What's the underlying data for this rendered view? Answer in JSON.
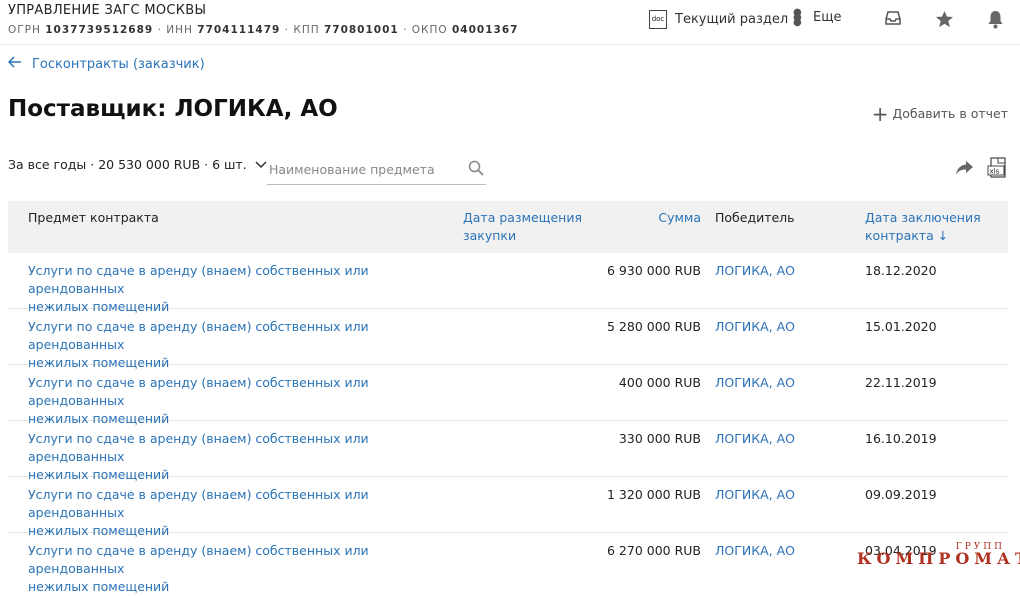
{
  "header": {
    "org_name": "УПРАВЛЕНИЕ ЗАГС МОСКВЫ",
    "ogrn_label": "ОГРН",
    "ogrn": "1037739512689",
    "inn_label": "ИНН",
    "inn": "7704111479",
    "kpp_label": "КПП",
    "kpp": "770801001",
    "okpo_label": "ОКПО",
    "okpo": "04001367",
    "separator": "·",
    "doc_icon_text": "doc",
    "current_section_label": "Текущий раздел",
    "more_label": "Еще"
  },
  "breadcrumb": {
    "back_label": "Госконтракты (заказчик)"
  },
  "page": {
    "title": "Поставщик: ЛОГИКА, АО",
    "add_report_label": "Добавить в отчет"
  },
  "filters": {
    "summary": "За все годы · 20 530 000 RUB · 6 шт.",
    "search_placeholder": "Наименование предмета",
    "xls_icon_text": "xls"
  },
  "table": {
    "columns": {
      "subject": "Предмет контракта",
      "placement_date_line1": "Дата размещения",
      "placement_date_line2": "закупки",
      "sum": "Сумма",
      "winner": "Победитель",
      "contract_date_line1": "Дата заключения",
      "contract_date_line2": "контракта ↓"
    },
    "rows": [
      {
        "subject_line1": "Услуги по сдаче в аренду (внаем) собственных или арендованных",
        "subject_line2": "нежилых помещений",
        "sum": "6 930 000 RUB",
        "winner": "ЛОГИКА, АО",
        "date": "18.12.2020"
      },
      {
        "subject_line1": "Услуги по сдаче в аренду (внаем) собственных или арендованных",
        "subject_line2": "нежилых помещений",
        "sum": "5 280 000 RUB",
        "winner": "ЛОГИКА, АО",
        "date": "15.01.2020"
      },
      {
        "subject_line1": "Услуги по сдаче в аренду (внаем) собственных или арендованных",
        "subject_line2": "нежилых помещений",
        "sum": "400 000 RUB",
        "winner": "ЛОГИКА, АО",
        "date": "22.11.2019"
      },
      {
        "subject_line1": "Услуги по сдаче в аренду (внаем) собственных или арендованных",
        "subject_line2": "нежилых помещений",
        "sum": "330 000 RUB",
        "winner": "ЛОГИКА, АО",
        "date": "16.10.2019"
      },
      {
        "subject_line1": "Услуги по сдаче в аренду (внаем) собственных или арендованных",
        "subject_line2": "нежилых помещений",
        "sum": "1 320 000 RUB",
        "winner": "ЛОГИКА, АО",
        "date": "09.09.2019"
      },
      {
        "subject_line1": "Услуги по сдаче в аренду (внаем) собственных или арендованных",
        "subject_line2": "нежилых помещений",
        "sum": "6 270 000 RUB",
        "winner": "ЛОГИКА, АО",
        "date": "03.04.2019"
      }
    ]
  },
  "watermark": {
    "small": "ГРУПП",
    "big": "КОМПРОМАТ"
  },
  "colors": {
    "link": "#2a73b8",
    "header_bg": "#f1f1f1",
    "watermark": "#b03020"
  },
  "icons": [
    "back-arrow-icon",
    "doc-icon",
    "more-dots-icon",
    "tray-icon",
    "star-icon",
    "bell-icon",
    "plus-icon",
    "chevron-down-icon",
    "search-icon",
    "share-icon",
    "xls-icon"
  ]
}
